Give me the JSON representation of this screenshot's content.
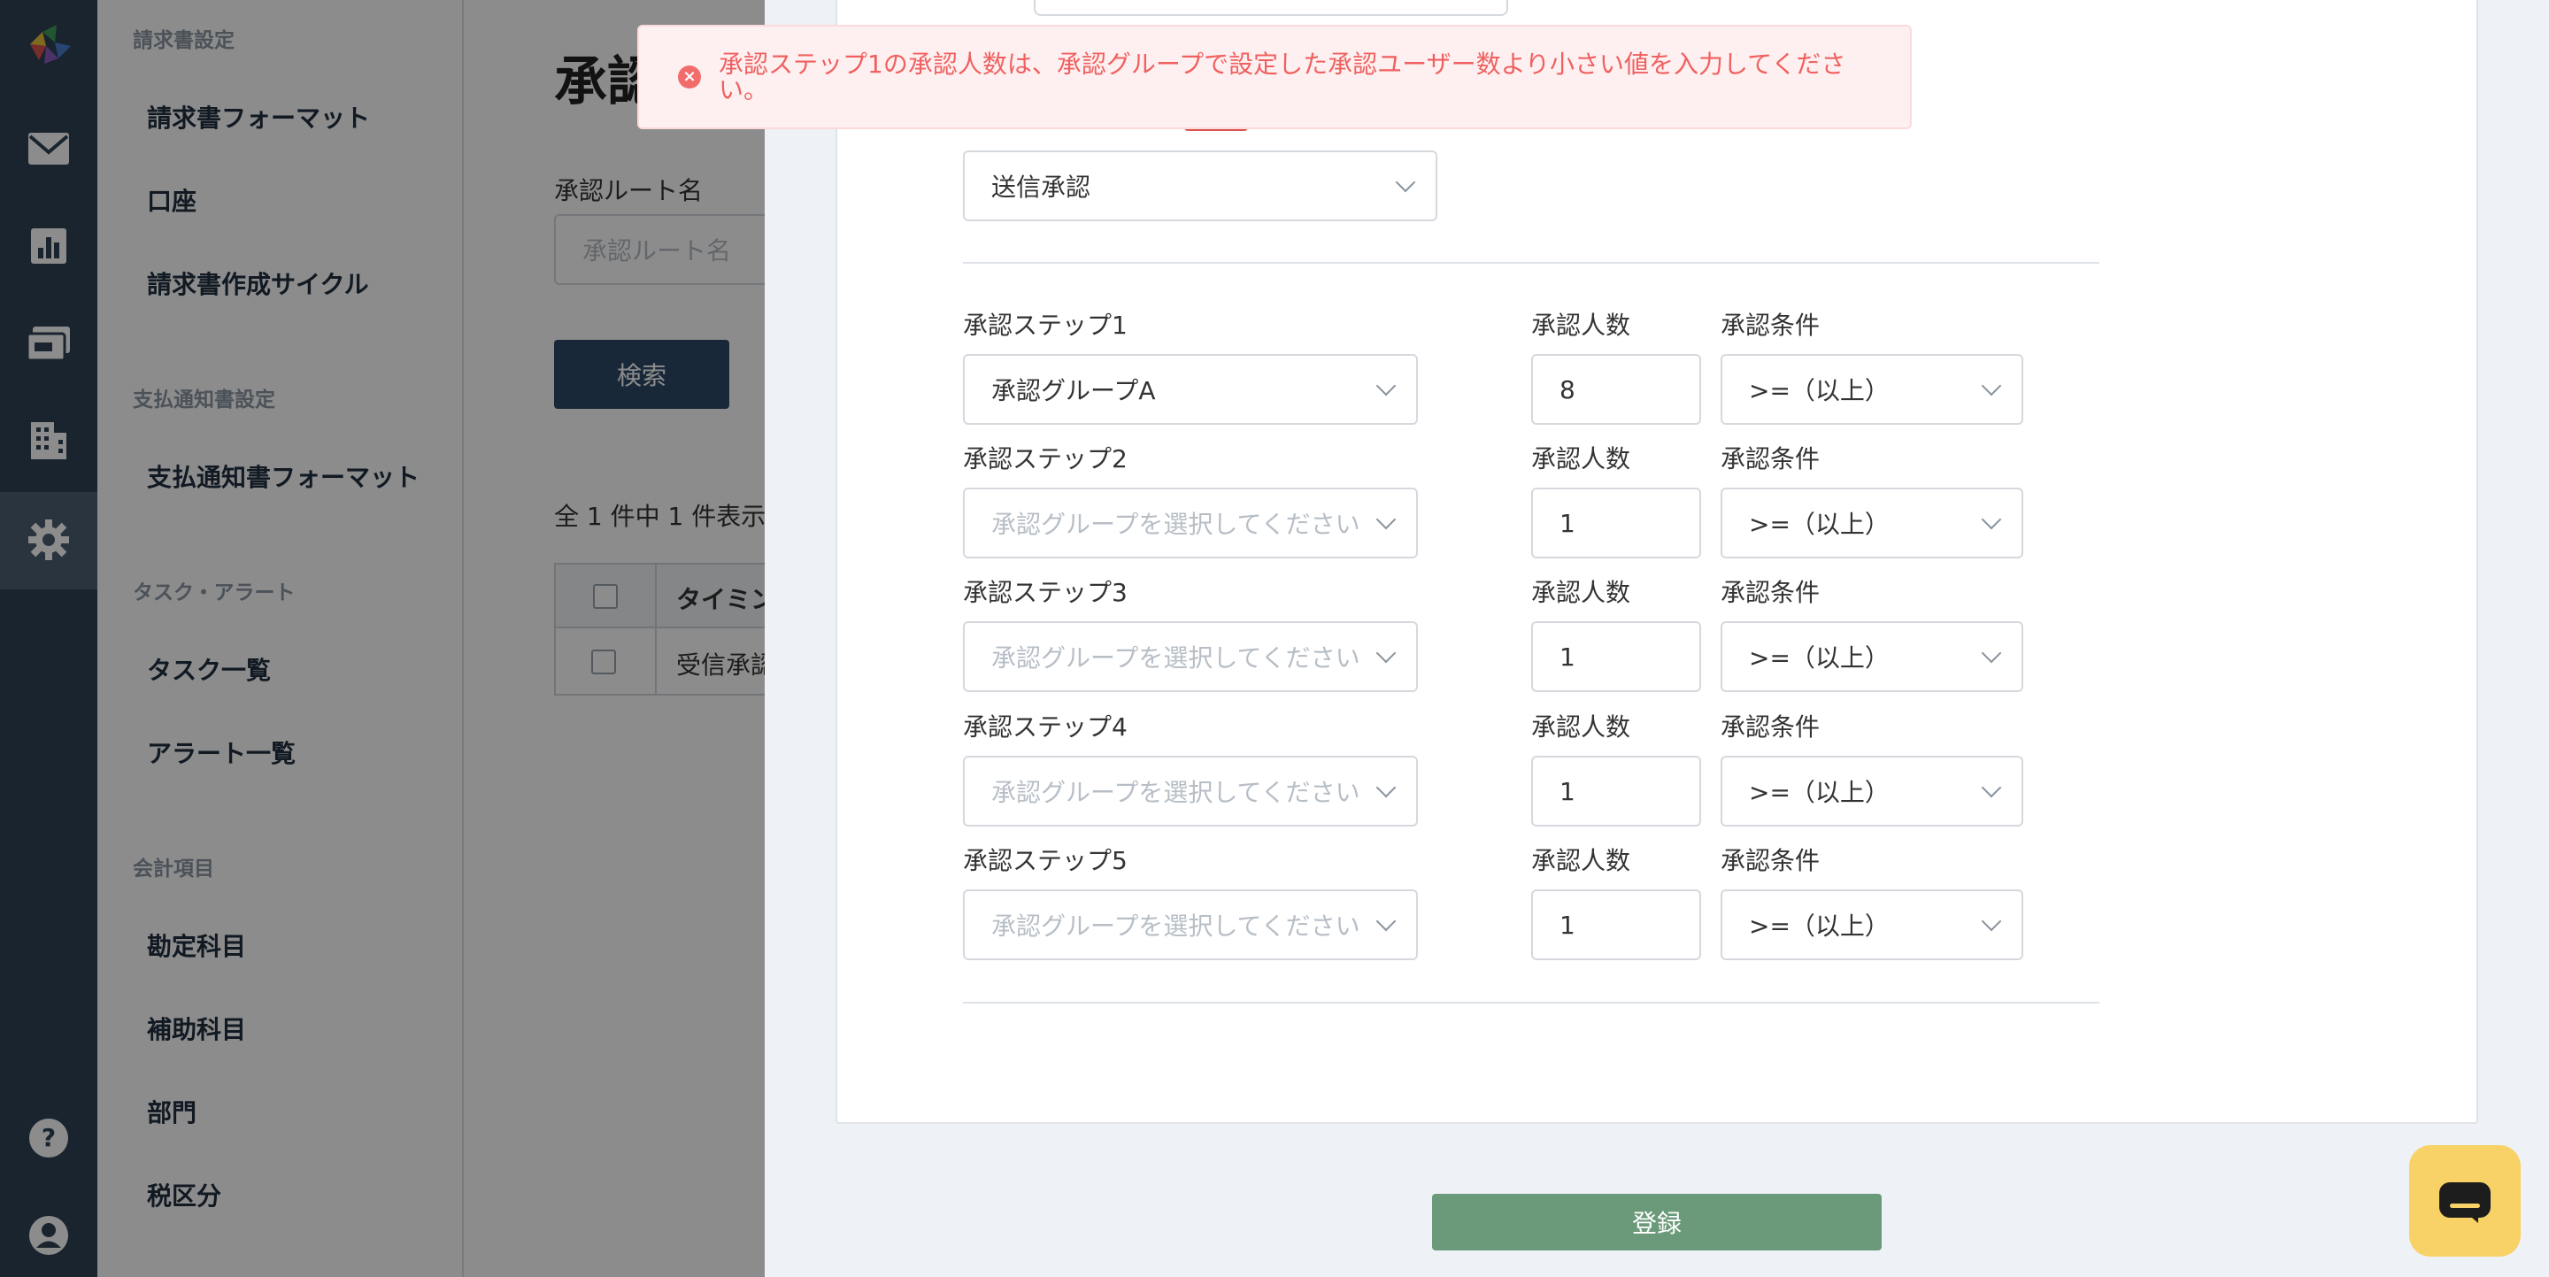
{
  "sidebar": {
    "sections": [
      {
        "title": "請求書設定",
        "items": [
          "請求書フォーマット",
          "口座",
          "請求書作成サイクル"
        ]
      },
      {
        "title": "支払通知書設定",
        "items": [
          "支払通知書フォーマット"
        ]
      },
      {
        "title": "タスク・アラート",
        "items": [
          "タスク一覧",
          "アラート一覧"
        ]
      },
      {
        "title": "会計項目",
        "items": [
          "勘定科目",
          "補助科目",
          "部門",
          "税区分"
        ]
      }
    ]
  },
  "rail_icons": [
    "logo-icon",
    "mail-icon",
    "chart-icon",
    "invoice-icon",
    "building-icon",
    "gear-icon",
    "help-icon",
    "user-icon"
  ],
  "main": {
    "page_title": "承認",
    "route_name_label": "承認ルート名",
    "route_name_placeholder": "承認ルート名",
    "search_button": "検索",
    "count_text": "全 1 件中 1 件表示し",
    "table_header": "タイミン",
    "table_cell": "受信承認"
  },
  "modal": {
    "timing_select": "送信承認",
    "steps": [
      {
        "label": "承認ステップ1",
        "group": "承認グループA",
        "placeholder": false,
        "count_label": "承認人数",
        "count": "8",
        "cond_label": "承認条件",
        "cond": ">=（以上）"
      },
      {
        "label": "承認ステップ2",
        "group": "承認グループを選択してください",
        "placeholder": true,
        "count_label": "承認人数",
        "count": "1",
        "cond_label": "承認条件",
        "cond": ">=（以上）"
      },
      {
        "label": "承認ステップ3",
        "group": "承認グループを選択してください",
        "placeholder": true,
        "count_label": "承認人数",
        "count": "1",
        "cond_label": "承認条件",
        "cond": ">=（以上）"
      },
      {
        "label": "承認ステップ4",
        "group": "承認グループを選択してください",
        "placeholder": true,
        "count_label": "承認人数",
        "count": "1",
        "cond_label": "承認条件",
        "cond": ">=（以上）"
      },
      {
        "label": "承認ステップ5",
        "group": "承認グループを選択してください",
        "placeholder": true,
        "count_label": "承認人数",
        "count": "1",
        "cond_label": "承認条件",
        "cond": ">=（以上）"
      }
    ],
    "submit_button": "登録"
  },
  "toast": {
    "message": "承認ステップ1の承認人数は、承認グループで設定した承認ユーザー数より小さい値を入力してください。"
  },
  "colors": {
    "rail": "#2f4254",
    "error": "#f06060",
    "submit": "#6a9a79",
    "chat": "#f9d267"
  }
}
